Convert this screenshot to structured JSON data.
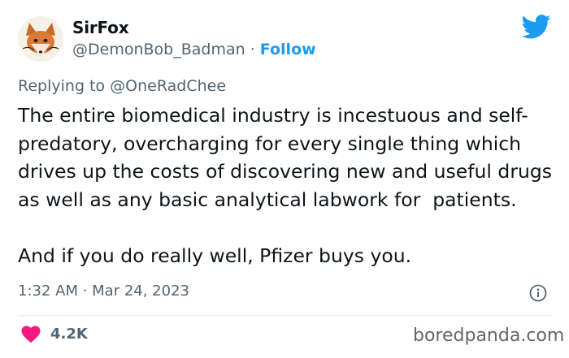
{
  "tweet": {
    "display_name": "SirFox",
    "handle": "@DemonBob_Badman",
    "separator": " · ",
    "follow_label": "Follow",
    "replying_prefix": "Replying to ",
    "replying_to": "@OneRadChee",
    "text": "The entire biomedical industry is incestuous and self-predatory, overcharging for every single thing which drives up the costs of discovering new and useful drugs as well as any basic analytical labwork for  patients.\n\nAnd if you do really well, Pfizer buys you.",
    "timestamp": "1:32 AM · Mar 24, 2023",
    "likes": "4.2K"
  },
  "icons": {
    "brand": "twitter-bird-icon",
    "info": "info-icon",
    "like": "heart-icon"
  },
  "colors": {
    "accent": "#1d9bf0",
    "heart": "#f91880",
    "muted": "#536471"
  },
  "watermark": "boredpanda.com"
}
